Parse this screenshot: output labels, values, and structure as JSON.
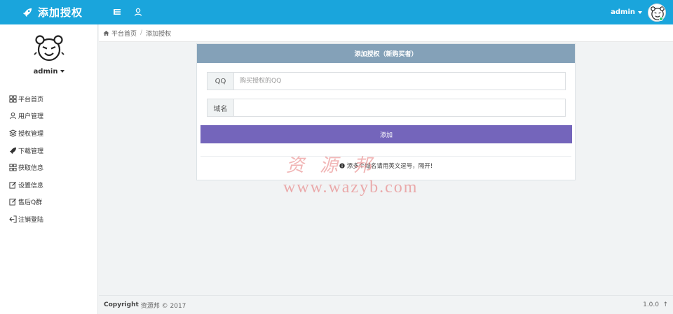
{
  "header": {
    "brand_title": "添加授权",
    "user_name": "admin"
  },
  "sidebar": {
    "user_name": "admin",
    "items": [
      {
        "label": "平台首页",
        "icon": "grid-icon"
      },
      {
        "label": "用户管理",
        "icon": "user-icon"
      },
      {
        "label": "授权管理",
        "icon": "layers-icon"
      },
      {
        "label": "下载管理",
        "icon": "rocket-icon"
      },
      {
        "label": "获取信息",
        "icon": "grid-icon"
      },
      {
        "label": "设置信息",
        "icon": "edit-icon"
      },
      {
        "label": "售后Q群",
        "icon": "edit-icon"
      },
      {
        "label": "注销登陆",
        "icon": "logout-icon"
      }
    ]
  },
  "breadcrumb": {
    "home": "平台首页",
    "separator": "/",
    "current": "添加授权"
  },
  "form": {
    "title": "添加授权（新购买者）",
    "qq_label": "QQ",
    "qq_placeholder": "购买授权的QQ",
    "qq_value": "",
    "domain_label": "域名",
    "domain_placeholder": "",
    "domain_value": "",
    "submit_label": "添加",
    "tip": "添多个域名请用英文逗号，隔开!"
  },
  "watermark": {
    "cn": "资源邦",
    "url": "www.wazyb.com"
  },
  "footer": {
    "copyright_bold": "Copyright",
    "copyright_text": "资源邦 © 2017",
    "version": "1.0.0",
    "top_arrow": "↑"
  },
  "colors": {
    "topbar": "#1aa5dc",
    "card_header": "#84a1b8",
    "submit_button": "#7465bb"
  }
}
